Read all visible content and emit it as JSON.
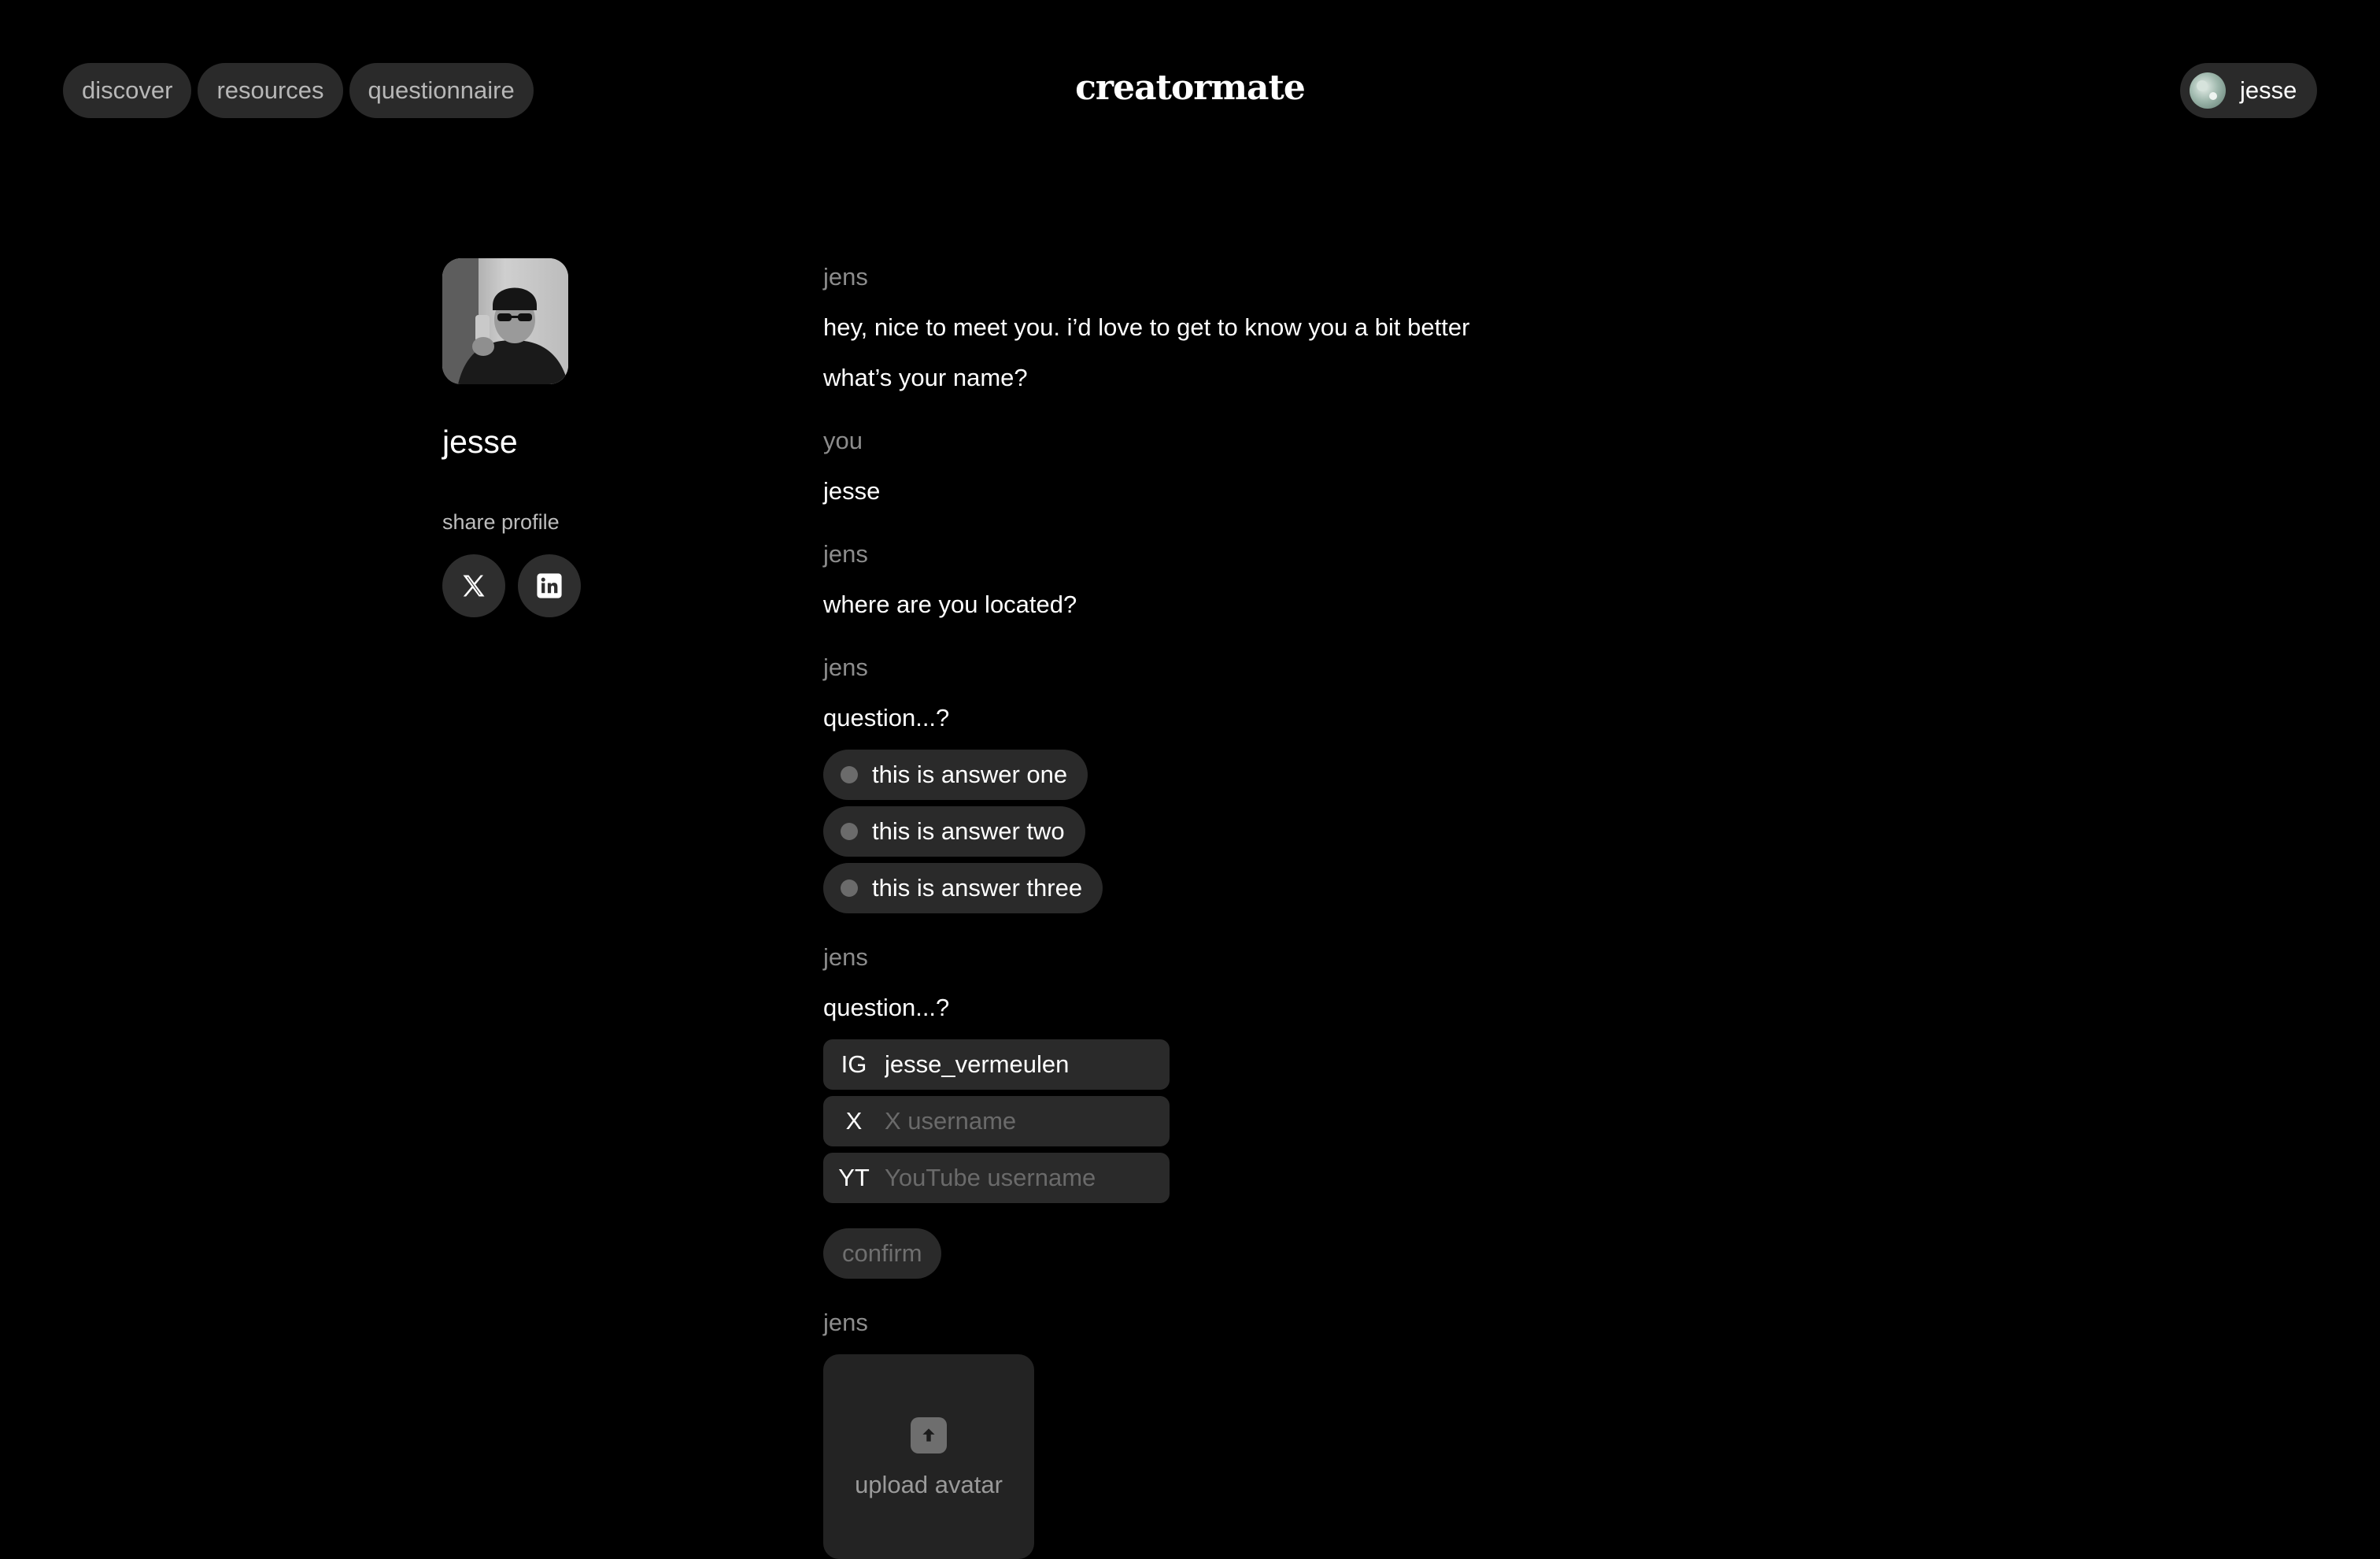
{
  "header": {
    "nav": [
      {
        "label": "discover"
      },
      {
        "label": "resources"
      },
      {
        "label": "questionnaire"
      }
    ],
    "logo": "creatormate",
    "user": {
      "name": "jesse",
      "avatar_icon": "user-avatar-icon"
    }
  },
  "profile": {
    "name": "jesse",
    "share_label": "share profile",
    "share_icons": [
      "x-icon",
      "linkedin-icon"
    ]
  },
  "chat": {
    "blocks": [
      {
        "sender": "jens",
        "lines": [
          "hey, nice to meet you. i’d love to get to know you a bit better",
          "what’s your name?"
        ]
      },
      {
        "sender": "you",
        "lines": [
          "jesse"
        ]
      },
      {
        "sender": "jens",
        "lines": [
          "where are you located?"
        ]
      },
      {
        "sender": "jens",
        "question": "question...?",
        "options": [
          "this is answer one",
          "this is answer two",
          "this is answer three"
        ]
      },
      {
        "sender": "jens",
        "question": "question...?",
        "fields": [
          {
            "prefix": "IG",
            "value": "jesse_vermeulen",
            "placeholder": ""
          },
          {
            "prefix": "X",
            "value": "",
            "placeholder": "X username"
          },
          {
            "prefix": "YT",
            "value": "",
            "placeholder": "YouTube username"
          }
        ],
        "confirm_label": "confirm"
      },
      {
        "sender": "jens",
        "upload_label": "upload avatar",
        "upload_icon": "upload-icon"
      }
    ]
  },
  "colors": {
    "background": "#000000",
    "pill": "#2a2a2a",
    "sender_text": "#8c8c8c",
    "muted_text": "#6f6f6f"
  }
}
